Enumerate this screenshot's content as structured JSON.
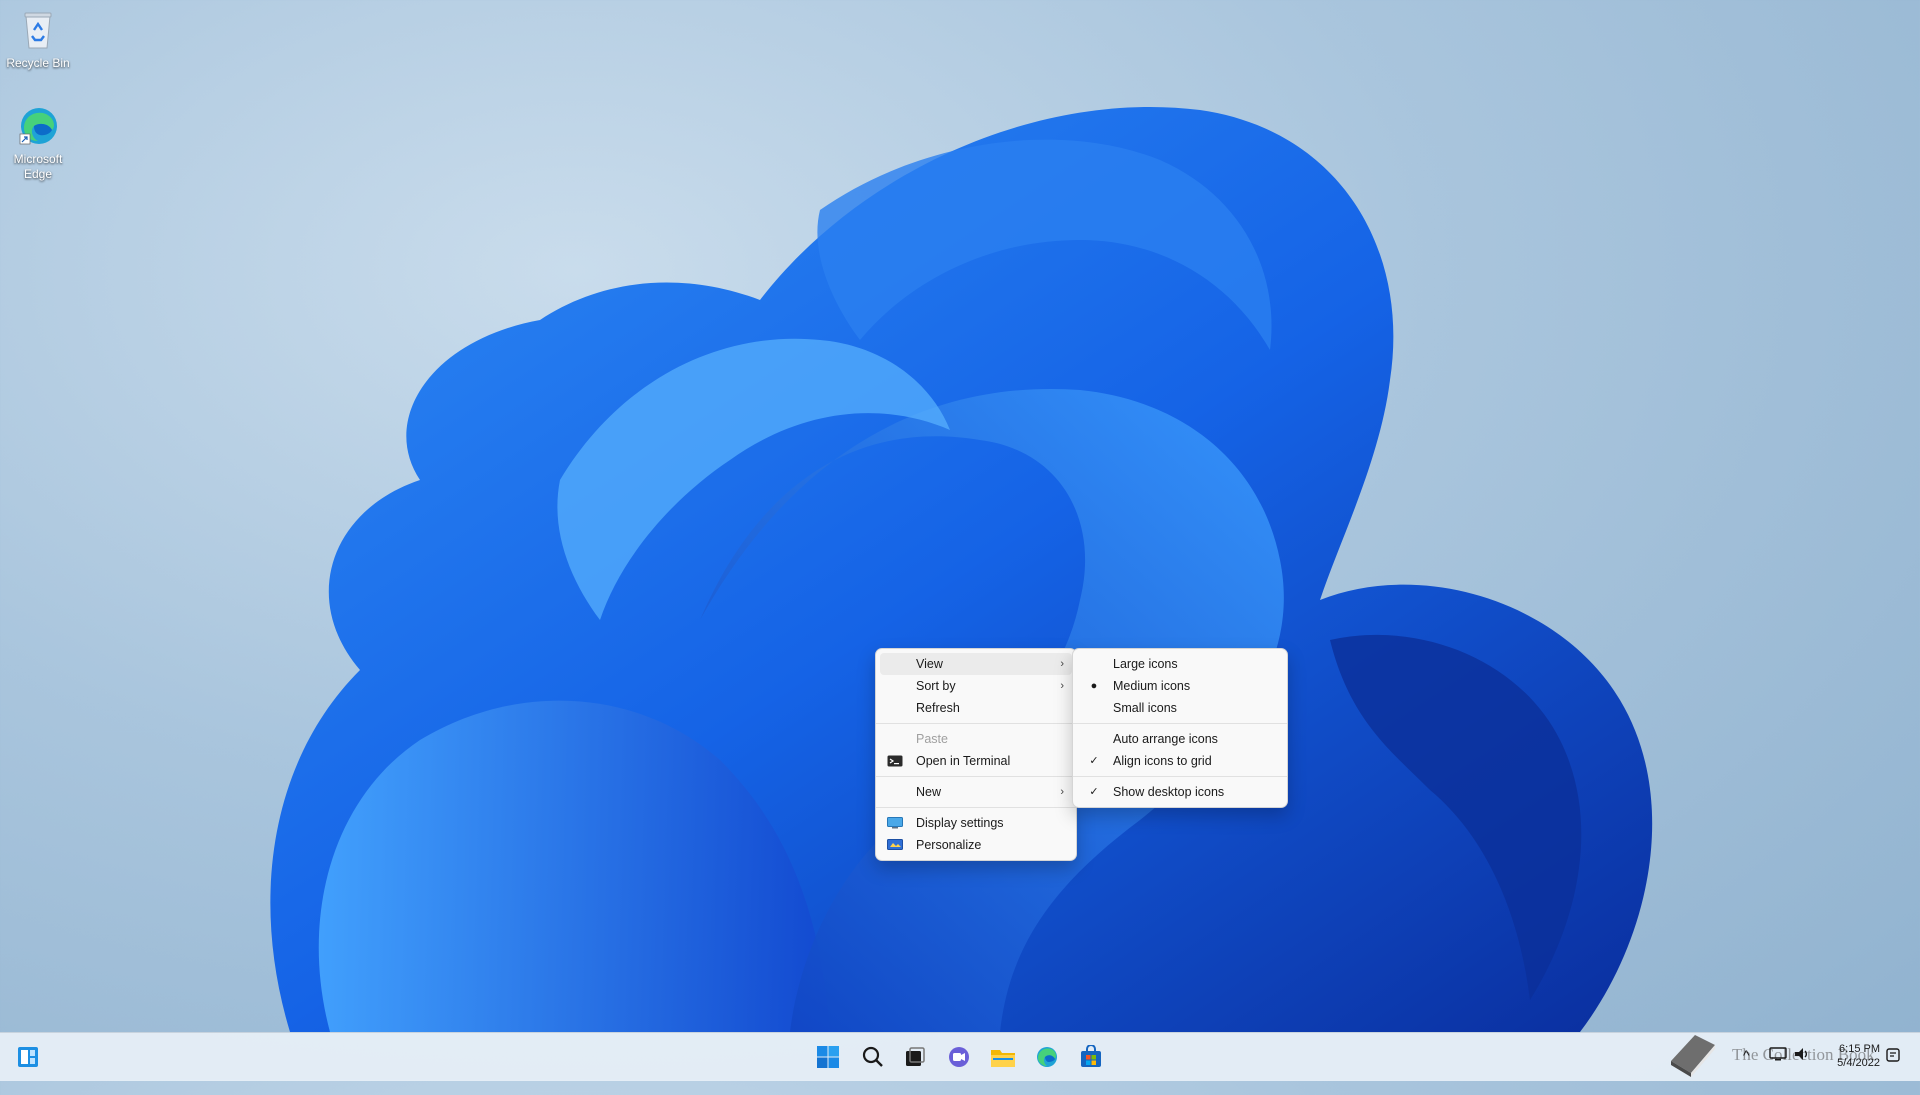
{
  "desktop": {
    "icons": [
      {
        "label": "Recycle Bin",
        "icon": "recycle-bin-icon"
      },
      {
        "label": "Microsoft Edge",
        "icon": "edge-icon"
      }
    ]
  },
  "context_menu": {
    "items": [
      {
        "label": "View",
        "submenu": true,
        "hovered": true
      },
      {
        "label": "Sort by",
        "submenu": true
      },
      {
        "label": "Refresh"
      },
      {
        "label": "Paste",
        "disabled": true
      },
      {
        "label": "Open in Terminal",
        "icon": "terminal-icon"
      },
      {
        "label": "New",
        "submenu": true
      },
      {
        "label": "Display settings",
        "icon": "display-icon"
      },
      {
        "label": "Personalize",
        "icon": "personalize-icon"
      }
    ]
  },
  "view_submenu": {
    "items": [
      {
        "label": "Large icons"
      },
      {
        "label": "Medium icons",
        "selected": true
      },
      {
        "label": "Small icons"
      },
      {
        "label": "Auto arrange icons"
      },
      {
        "label": "Align icons to grid",
        "checked": true
      },
      {
        "label": "Show desktop icons",
        "checked": true
      }
    ]
  },
  "taskbar": {
    "apps": [
      "start-icon",
      "search-icon",
      "task-view-icon",
      "chat-icon",
      "file-explorer-icon",
      "edge-icon",
      "store-icon"
    ],
    "tray": {
      "time": "6:15 PM",
      "date": "5/4/2022",
      "watermark": "The Collection Book"
    },
    "colors": {
      "accent": "#0067c0"
    }
  }
}
